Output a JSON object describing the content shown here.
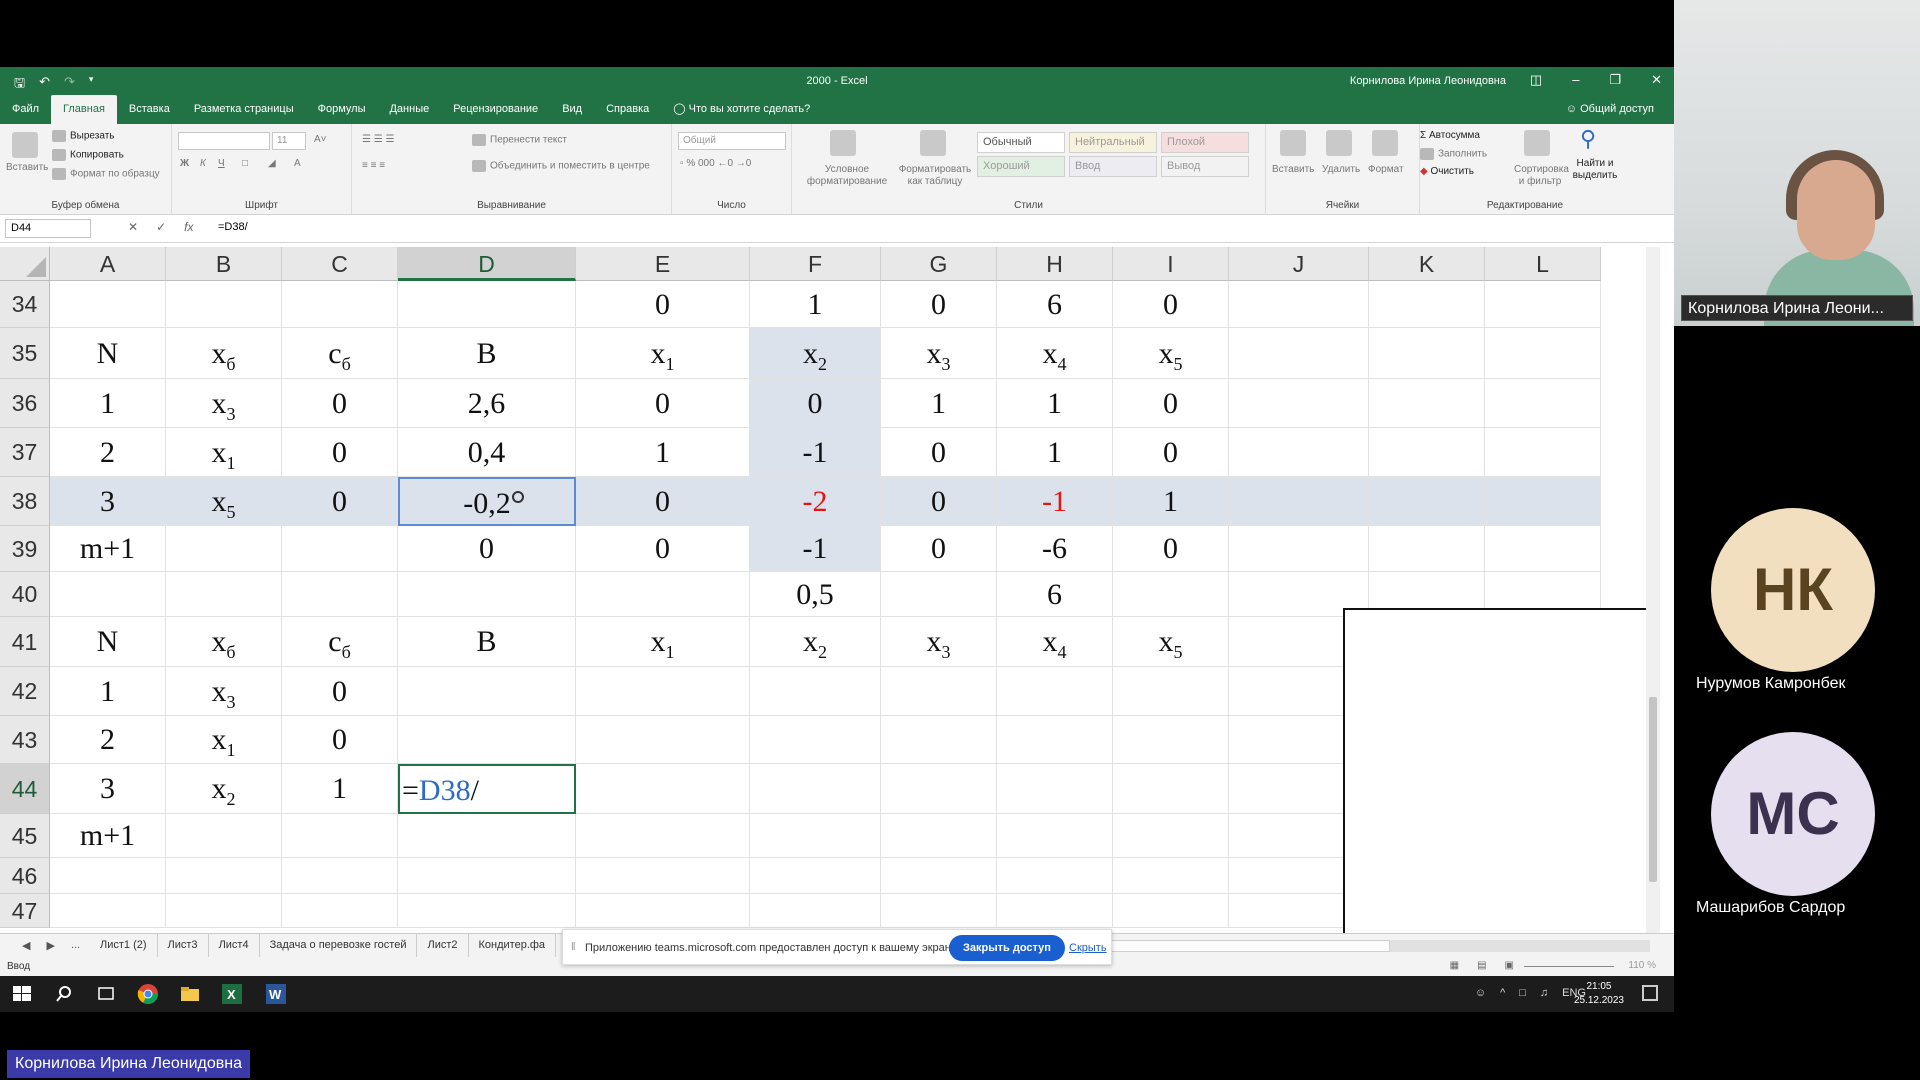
{
  "excel": {
    "title": "2000  -  Excel",
    "user": "Корнилова Ирина Леонидовна",
    "menu_tabs": [
      "Файл",
      "Главная",
      "Вставка",
      "Разметка страницы",
      "Формулы",
      "Данные",
      "Рецензирование",
      "Вид",
      "Справка"
    ],
    "tell_me": "Что вы хотите сделать?",
    "share": "Общий доступ",
    "ribbon": {
      "clipboard": {
        "label": "Буфер обмена",
        "paste": "Вставить",
        "cut": "Вырезать",
        "copy": "Копировать",
        "format_painter": "Формат по образцу"
      },
      "font": {
        "label": "Шрифт",
        "size": "11",
        "bold": "Ж",
        "italic": "К",
        "underline": "Ч"
      },
      "alignment": {
        "label": "Выравнивание",
        "wrap": "Перенести текст",
        "merge": "Объединить и поместить в центре"
      },
      "number": {
        "label": "Число",
        "format": "Общий"
      },
      "styles": {
        "label": "Стили",
        "conditional": "Условное форматирование",
        "as_table": "Форматировать как таблицу",
        "normal": "Обычный",
        "neutral": "Нейтральный",
        "bad": "Плохой",
        "good": "Хороший",
        "input": "Ввод",
        "output": "Вывод"
      },
      "cells": {
        "label": "Ячейки",
        "insert": "Вставить",
        "delete": "Удалить",
        "format": "Формат"
      },
      "editing": {
        "label": "Редактирование",
        "autosum": "Автосумма",
        "fill": "Заполнить",
        "clear": "Очистить",
        "sort": "Сортировка и фильтр",
        "find": "Найти и выделить"
      }
    },
    "name_box": "D44",
    "formula": "=D38/",
    "columns": [
      "A",
      "B",
      "C",
      "D",
      "E",
      "F",
      "G",
      "H",
      "I",
      "J",
      "K",
      "L"
    ],
    "rows": [
      "34",
      "35",
      "36",
      "37",
      "38",
      "39",
      "40",
      "41",
      "42",
      "43",
      "44",
      "45",
      "46",
      "47"
    ],
    "cells": {
      "r34": {
        "E": "0",
        "F": "1",
        "G": "0",
        "H": "6",
        "I": "0"
      },
      "r35": {
        "A": "N",
        "B": "x",
        "B_sub": "б",
        "C": "c",
        "C_sub": "б",
        "D": "B",
        "E": "x",
        "E_sub": "1",
        "F": "x",
        "F_sub": "2",
        "G": "x",
        "G_sub": "3",
        "H": "x",
        "H_sub": "4",
        "I": "x",
        "I_sub": "5"
      },
      "r36": {
        "A": "1",
        "B": "x",
        "B_sub": "3",
        "C": "0",
        "D": "2,6",
        "E": "0",
        "F": "0",
        "G": "1",
        "H": "1",
        "I": "0"
      },
      "r37": {
        "A": "2",
        "B": "x",
        "B_sub": "1",
        "C": "0",
        "D": "0,4",
        "E": "1",
        "F": "-1",
        "G": "0",
        "H": "1",
        "I": "0"
      },
      "r38": {
        "A": "3",
        "B": "x",
        "B_sub": "5",
        "C": "0",
        "D": "-0,2",
        "E": "0",
        "F": "-2",
        "G": "0",
        "H": "-1",
        "I": "1"
      },
      "r39": {
        "A": "m+1",
        "D": "0",
        "E": "0",
        "F": "-1",
        "G": "0",
        "H": "-6",
        "I": "0"
      },
      "r40": {
        "F": "0,5",
        "H": "6"
      },
      "r41": {
        "A": "N",
        "B": "x",
        "B_sub": "б",
        "C": "c",
        "C_sub": "б",
        "D": "B",
        "E": "x",
        "E_sub": "1",
        "F": "x",
        "F_sub": "2",
        "G": "x",
        "G_sub": "3",
        "H": "x",
        "H_sub": "4",
        "I": "x",
        "I_sub": "5"
      },
      "r42": {
        "A": "1",
        "B": "x",
        "B_sub": "3",
        "C": "0"
      },
      "r43": {
        "A": "2",
        "B": "x",
        "B_sub": "1",
        "C": "0"
      },
      "r44": {
        "A": "3",
        "B": "x",
        "B_sub": "2",
        "C": "1",
        "D_prefix": "=",
        "D_ref": "D38",
        "D_suffix": "/"
      },
      "r45": {
        "A": "m+1"
      }
    },
    "sheet_tabs": [
      "Лист1 (2)",
      "Лист3",
      "Лист4",
      "Задача о перевозке гостей",
      "Лист2",
      "Кондитер.фа"
    ],
    "sheet_nav_more": "...",
    "status_mode": "Ввод",
    "zoom": "110 %"
  },
  "share_notification": {
    "message": "Приложению teams.microsoft.com предоставлен доступ к вашему экрану.",
    "stop": "Закрыть доступ",
    "hide": "Скрыть"
  },
  "taskbar": {
    "lang": "ENG",
    "time": "21:05",
    "date": "25.12.2023"
  },
  "meeting": {
    "presenter_name": "Корнилова Ирина Леони...",
    "participants": [
      {
        "initials": "НК",
        "name": "Нурумов Камронбек",
        "color": "#f2dfc0"
      },
      {
        "initials": "МС",
        "name": "Машарибов  Сардор",
        "color": "#e6dff0"
      }
    ],
    "bottom_name": "Корнилова Ирина Леонидовна"
  },
  "colors": {
    "excel_green": "#217346",
    "highlight": "#dbe2ec",
    "red_value": "#e81313",
    "teams_button": "#1a5fd0"
  }
}
